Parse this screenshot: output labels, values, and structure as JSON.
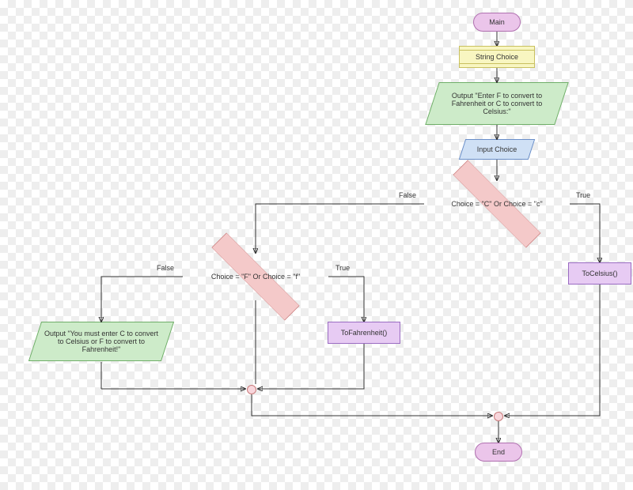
{
  "nodes": {
    "main": "Main",
    "declare": "String Choice",
    "prompt": "Output \"Enter F to convert to Fahrenheit or C to convert to Celsius:\"",
    "input": "Input Choice",
    "decision1": "Choice = \"C\" Or Choice = \"c\"",
    "decision2": "Choice = \"F\" Or Choice = \"f\"",
    "toCelsius": "ToCelsius()",
    "toFahrenheit": "ToFahrenheit()",
    "error": "Output \"You must enter C to convert to Celsius or F to convert to Fahrenheit!\"",
    "end": "End"
  },
  "labels": {
    "true": "True",
    "false": "False"
  }
}
